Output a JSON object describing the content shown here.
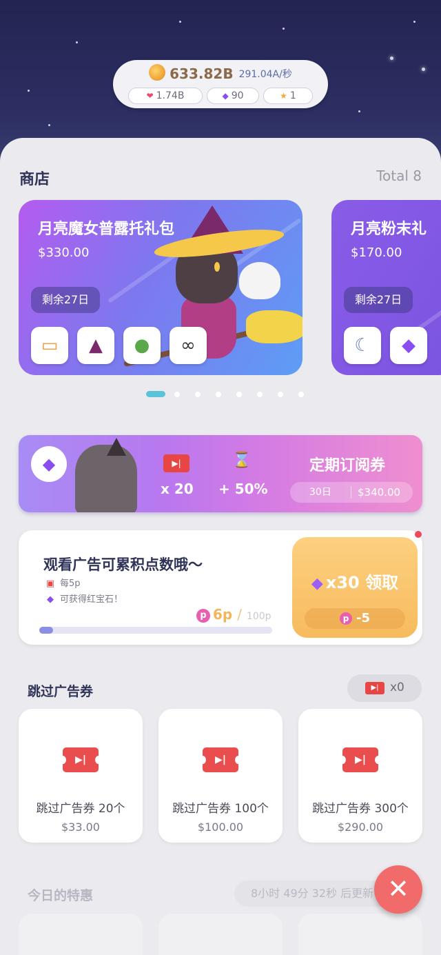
{
  "currency": {
    "coins": "633.82B",
    "rate": "291.04A/秒",
    "hearts": "1.74B",
    "gems": "90",
    "stars": "1"
  },
  "shop": {
    "title": "商店",
    "total": "Total 8",
    "gifts": [
      {
        "title": "月亮魔女普露托礼包",
        "price": "$330.00",
        "remain": "剩余27日"
      },
      {
        "title": "月亮粉末礼",
        "price": "$170.00",
        "remain": "剩余27日"
      }
    ]
  },
  "subscription": {
    "title": "定期订阅券",
    "bonus1": "x 20",
    "bonus2": "+ 50%",
    "days": "30日",
    "price": "$340.00"
  },
  "ad": {
    "headline": "观看广告可累积点数哦～",
    "line1": "每5p",
    "line2": "可获得红宝石！",
    "points": "6p",
    "slash": "/",
    "max": "100p",
    "progress": 0.06,
    "claim_label": "x30 领取",
    "claim_cost": "-5"
  },
  "skip": {
    "title": "跳过广告券",
    "count": "x0",
    "items": [
      {
        "name": "跳过广告券 20个",
        "price": "$33.00"
      },
      {
        "name": "跳过广告券 100个",
        "price": "$100.00"
      },
      {
        "name": "跳过广告券 300个",
        "price": "$290.00"
      }
    ]
  },
  "deals": {
    "title": "今日的特惠",
    "timer": "8小时 49分 32秒 后更新"
  },
  "icons": {
    "close": "✕",
    "gem": "◆",
    "heart": "❤",
    "star": "★",
    "ticket": "▶|",
    "hourglass": "⌛",
    "points": "p"
  },
  "colors": {
    "accent": "#5bc3d9",
    "ticket_red": "#e84545",
    "close_btn": "#f26b6b",
    "claim_orange": "#f7bb5e"
  }
}
